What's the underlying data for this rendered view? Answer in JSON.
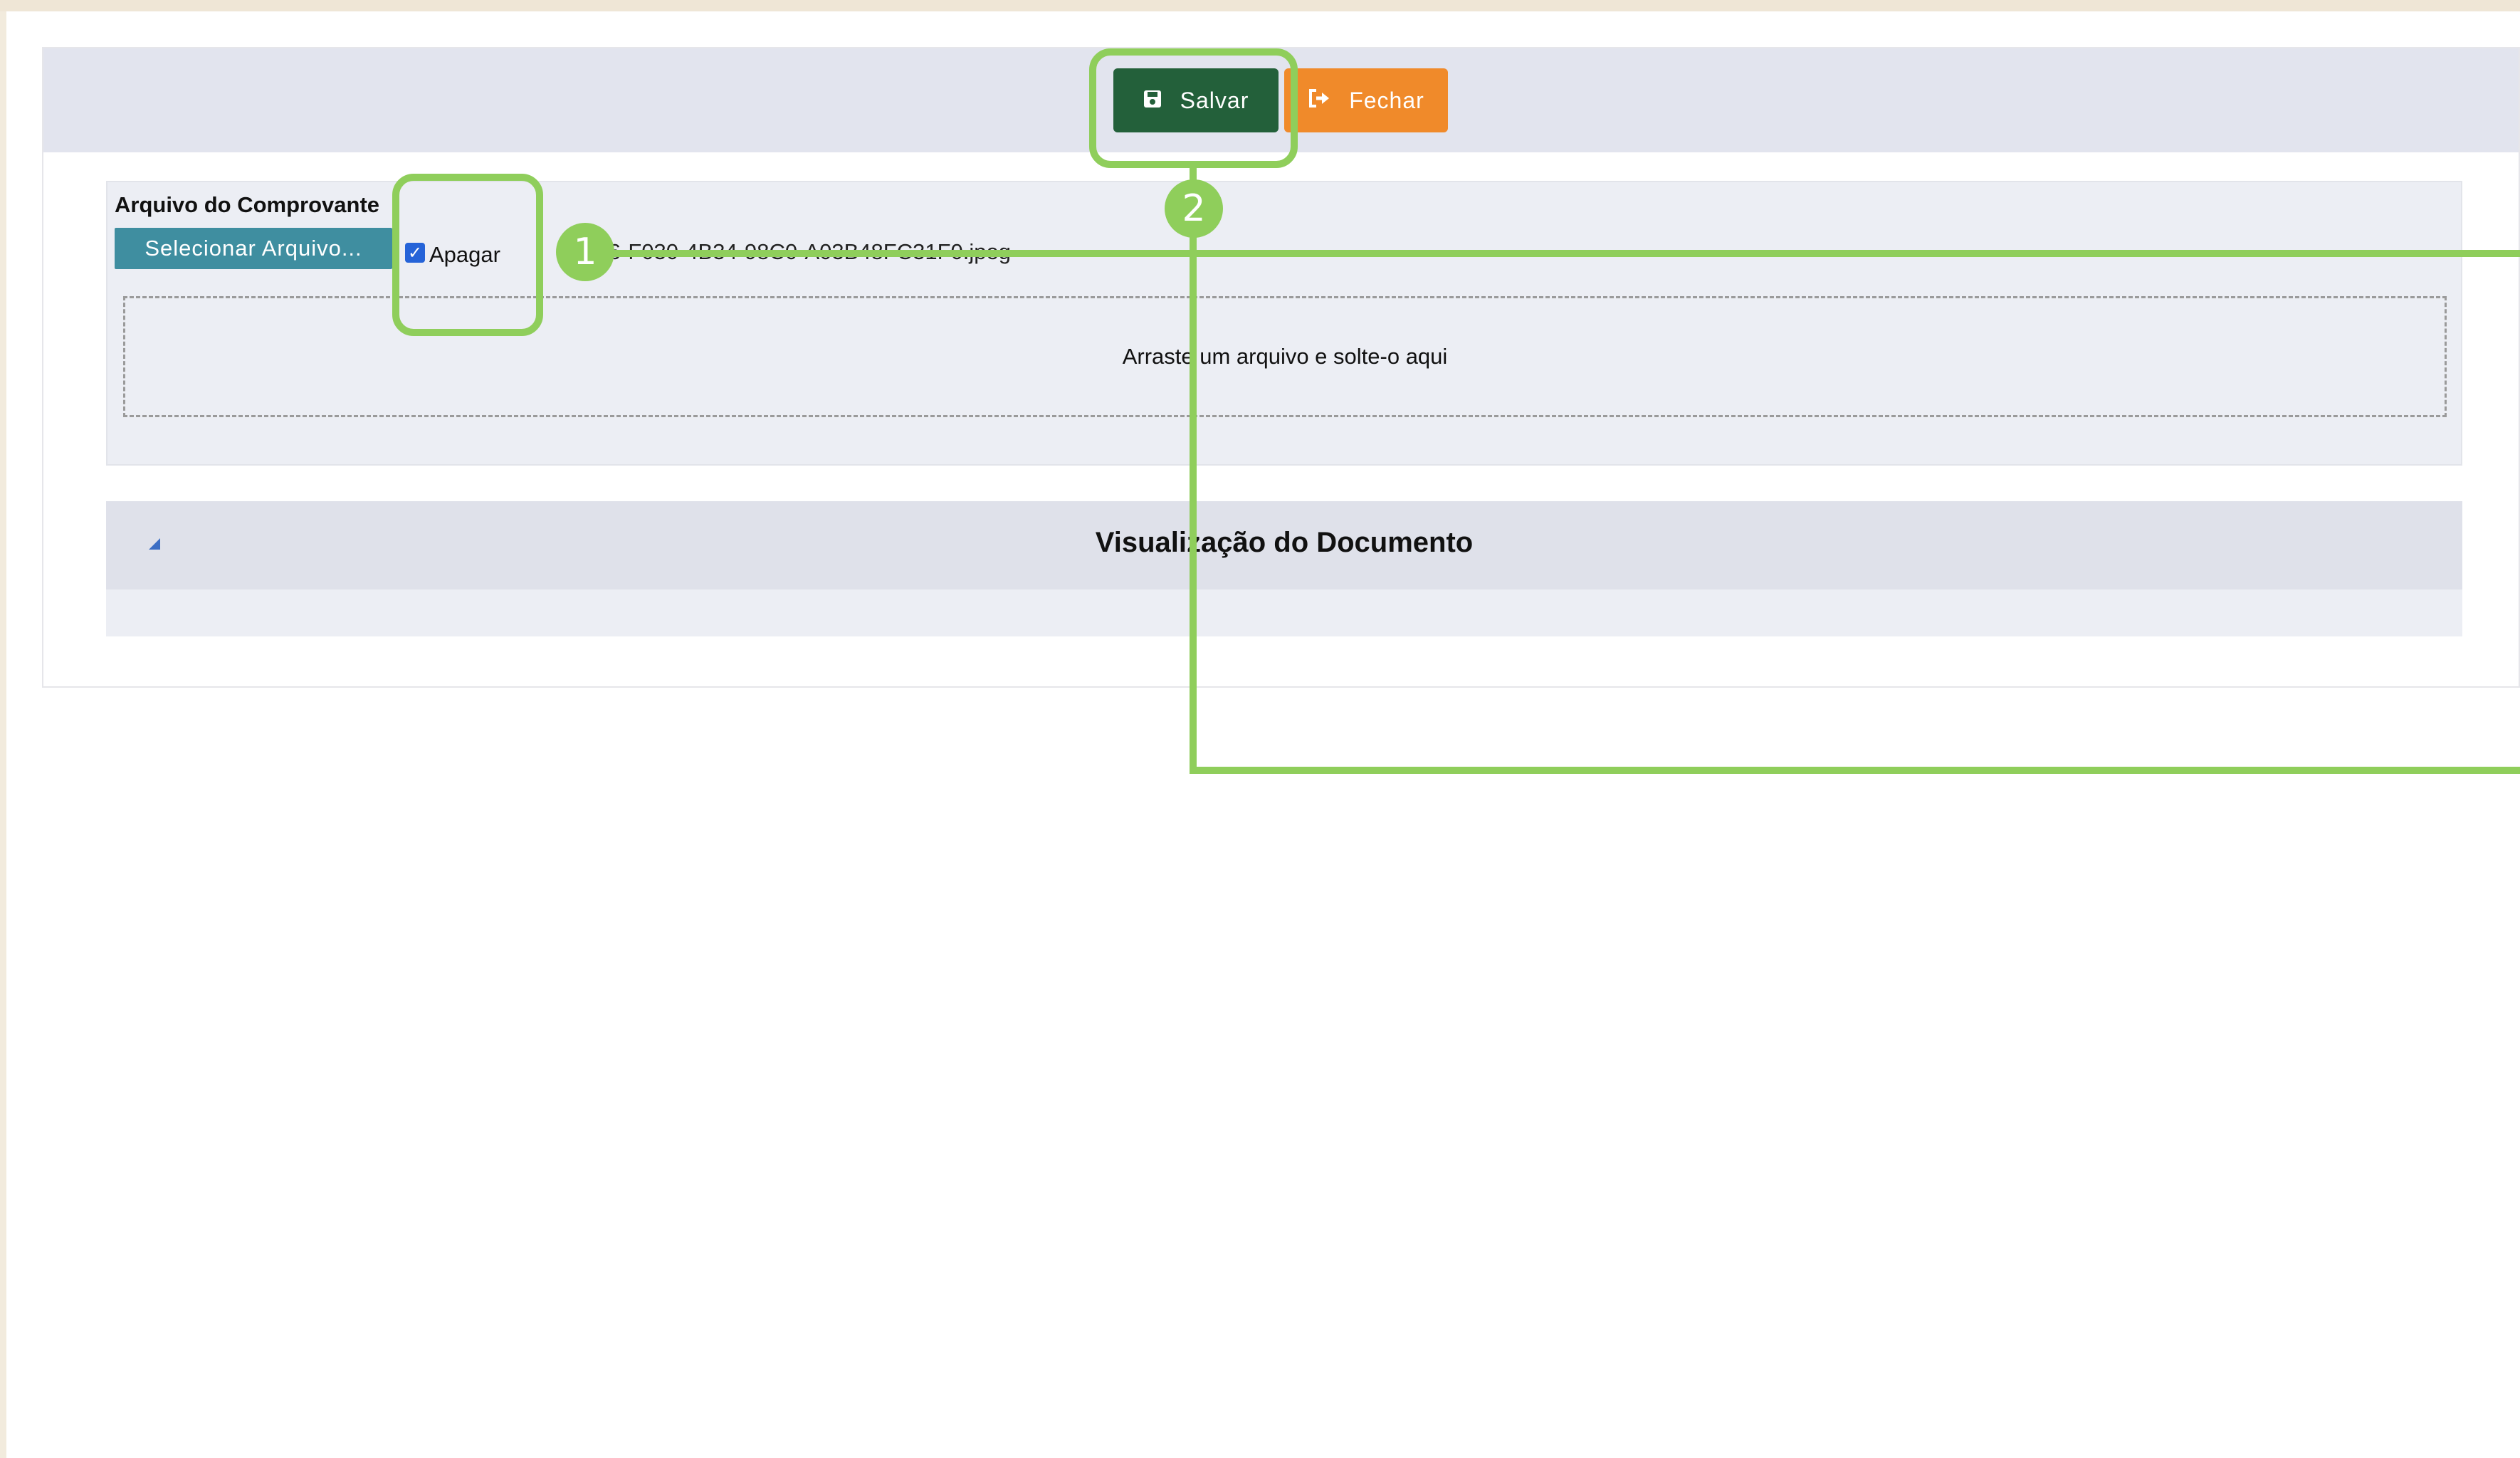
{
  "toolbar": {
    "save_label": "Salvar",
    "close_label": "Fechar"
  },
  "upload": {
    "title": "Arquivo do Comprovante",
    "select_button": "Selecionar Arquivo...",
    "delete_checkbox_label": "Apagar",
    "delete_checked": true,
    "filename": "B...26-F030-4B34-98C0-A03B48FC31F0.jpeg",
    "dropzone_text": "Arraste um arquivo e solte-o aqui"
  },
  "viewer": {
    "title": "Visualização do Documento"
  },
  "callouts": [
    {
      "number": "1"
    },
    {
      "number": "2"
    }
  ],
  "colors": {
    "save_button": "#23603a",
    "close_button": "#f08a2a",
    "select_button": "#3f8ea0",
    "callout": "#8fce5b"
  },
  "icons": {
    "save": "save-icon",
    "close": "sign-out-icon",
    "toggle": "collapse-triangle-icon"
  }
}
